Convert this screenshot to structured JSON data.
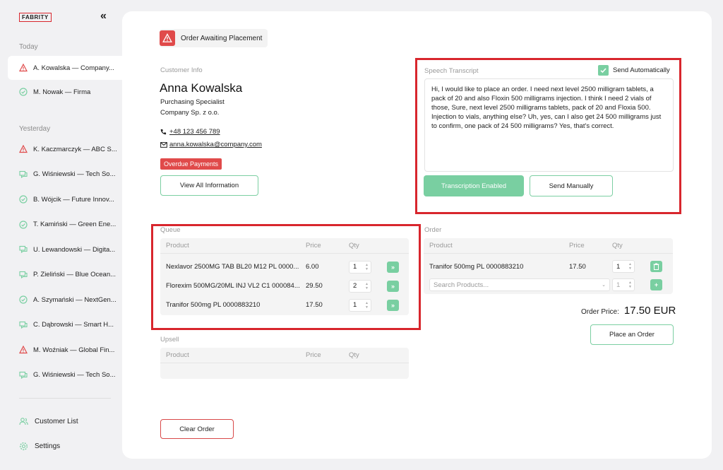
{
  "sidebar": {
    "logo": "FABRITY",
    "collapse_icon": "chevrons-left-icon",
    "today_label": "Today",
    "yesterday_label": "Yesterday",
    "today_items": [
      {
        "label": "A. Kowalska — Company...",
        "icon": "warning-icon"
      },
      {
        "label": "M. Nowak — Firma",
        "icon": "check-circle-icon"
      }
    ],
    "yesterday_items": [
      {
        "label": "K. Kaczmarczyk — ABC S...",
        "icon": "warning-icon"
      },
      {
        "label": "G. Wiśniewski — Tech So...",
        "icon": "chat-icon"
      },
      {
        "label": "B. Wójcik — Future Innov...",
        "icon": "check-circle-icon"
      },
      {
        "label": "T. Kamiński — Green Ene...",
        "icon": "check-circle-icon"
      },
      {
        "label": "U. Lewandowski — Digita...",
        "icon": "chat-icon"
      },
      {
        "label": "P. Zieliński — Blue Ocean...",
        "icon": "chat-icon"
      },
      {
        "label": "A. Szymański — NextGen...",
        "icon": "check-circle-icon"
      },
      {
        "label": "C. Dąbrowski — Smart H...",
        "icon": "chat-icon"
      },
      {
        "label": "M. Woźniak — Global Fin...",
        "icon": "warning-icon"
      },
      {
        "label": "G. Wiśniewski — Tech So...",
        "icon": "chat-icon"
      }
    ],
    "customer_list": "Customer List",
    "settings": "Settings"
  },
  "status": {
    "label": "Order Awaiting Placement"
  },
  "customer": {
    "section_label": "Customer Info",
    "name": "Anna Kowalska",
    "title": "Purchasing Specialist",
    "company": "Company Sp. z o.o.",
    "phone": "+48 123 456 789",
    "email": "anna.kowalska@company.com",
    "badge": "Overdue Payments",
    "view_all": "View All Information"
  },
  "transcript": {
    "label": "Speech Transcript",
    "send_auto_label": "Send Automatically",
    "send_auto_checked": true,
    "text": "Hi, I would like to place an order. I need next level 2500 milligram tablets, a pack of 20 and also Floxin 500 milligrams injection. I think I need 2 vials of those, Sure, next level 2500 milligrams tablets, pack of 20 and Floxia 500. Injection to vials, anything else? Uh, yes, can I also get 24 500 milligrams just to confirm, one pack of 24 500 milligrams? Yes, that's correct.",
    "transcription_btn": "Transcription Enabled",
    "send_manually_btn": "Send Manually"
  },
  "queue": {
    "label": "Queue",
    "headers": {
      "product": "Product",
      "price": "Price",
      "qty": "Qty"
    },
    "rows": [
      {
        "product": "Nexlavor 2500MG TAB BL20 M12 PL 0000...",
        "price": "6.00",
        "qty": "1"
      },
      {
        "product": "Florexim 500MG/20ML INJ VL2 C1 000084...",
        "price": "29.50",
        "qty": "2"
      },
      {
        "product": "Tranifor 500mg PL 0000883210",
        "price": "17.50",
        "qty": "1"
      }
    ]
  },
  "upsell": {
    "label": "Upsell",
    "headers": {
      "product": "Product",
      "price": "Price",
      "qty": "Qty"
    }
  },
  "order": {
    "label": "Order",
    "headers": {
      "product": "Product",
      "price": "Price",
      "qty": "Qty"
    },
    "rows": [
      {
        "product": "Tranifor 500mg PL 0000883210",
        "price": "17.50",
        "qty": "1"
      }
    ],
    "search_placeholder": "Search Products...",
    "new_qty": "1",
    "price_label": "Order Price:",
    "price_value": "17.50 EUR",
    "place_btn": "Place an Order"
  },
  "clear_btn": "Clear Order",
  "colors": {
    "accent_green": "#79cfa1",
    "alert_red": "#e04a4a",
    "highlight_red": "#d8262d"
  }
}
